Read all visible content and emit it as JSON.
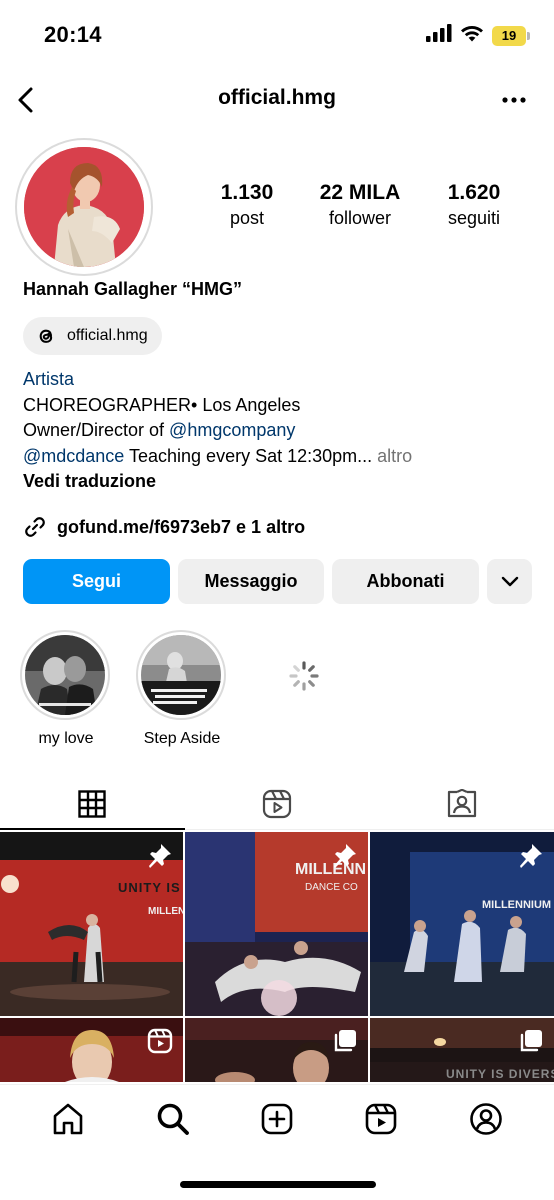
{
  "status_bar": {
    "time": "20:14",
    "battery": "19"
  },
  "header": {
    "username": "official.hmg"
  },
  "stats": [
    {
      "value": "1.130",
      "label": "post"
    },
    {
      "value": "22 MILA",
      "label": "follower"
    },
    {
      "value": "1.620",
      "label": "seguiti"
    }
  ],
  "profile": {
    "display_name": "Hannah Gallagher “HMG”",
    "threads_handle": "official.hmg",
    "category": "Artista",
    "bio_line1": "CHOREOGRAPHER• Los Angeles",
    "bio_line2_prefix": "Owner/Director of ",
    "bio_line2_mention": "@hmgcompany",
    "bio_line3_mention": "@mdcdance",
    "bio_line3_text": " Teaching every Sat 12:30pm...",
    "bio_more": " altro",
    "translate": "Vedi traduzione",
    "link": "gofund.me/f6973eb7 e 1 altro"
  },
  "actions": {
    "follow": "Segui",
    "message": "Messaggio",
    "subscribe": "Abbonati"
  },
  "highlights": [
    {
      "label": "my love"
    },
    {
      "label": "Step Aside"
    }
  ],
  "tabs": [
    "grid-icon",
    "reels-icon",
    "tagged-icon"
  ],
  "posts": [
    {
      "type": "pinned",
      "caption": "UNITY IS E",
      "sub": "MILLEN"
    },
    {
      "type": "pinned",
      "caption": "MILLENN",
      "sub": "DANCE CO"
    },
    {
      "type": "pinned",
      "caption": "MILLENNIUM",
      "sub": ""
    },
    {
      "type": "reel"
    },
    {
      "type": "multi"
    },
    {
      "type": "multi",
      "caption": "UNITY IS DIVERSE"
    }
  ],
  "colors": {
    "accent": "#0095f6",
    "link": "#00376b",
    "battery": "#f2d94a"
  }
}
